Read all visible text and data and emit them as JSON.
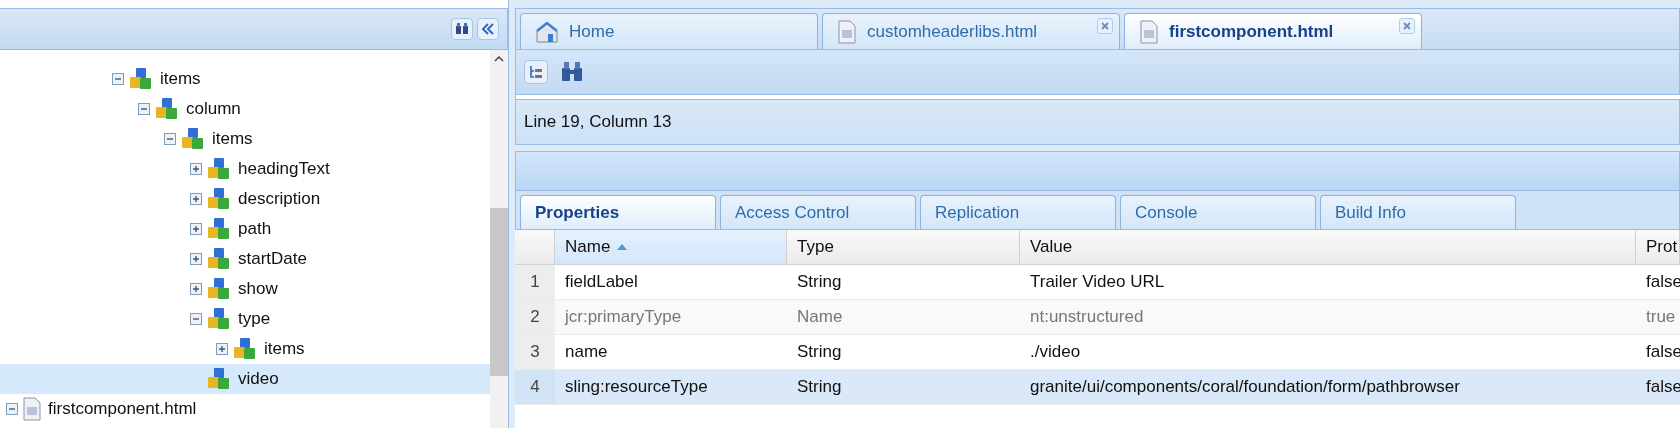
{
  "tree": [
    {
      "label": "items",
      "kind": "node",
      "expanded": true,
      "selected": false,
      "children": [
        {
          "label": "column",
          "kind": "node",
          "expanded": true,
          "selected": false,
          "children": [
            {
              "label": "items",
              "kind": "node",
              "expanded": true,
              "selected": false,
              "children": [
                {
                  "label": "headingText",
                  "kind": "node",
                  "expanded": false,
                  "selected": false
                },
                {
                  "label": "description",
                  "kind": "node",
                  "expanded": false,
                  "selected": false
                },
                {
                  "label": "path",
                  "kind": "node",
                  "expanded": false,
                  "selected": false
                },
                {
                  "label": "startDate",
                  "kind": "node",
                  "expanded": false,
                  "selected": false
                },
                {
                  "label": "show",
                  "kind": "node",
                  "expanded": false,
                  "selected": false
                },
                {
                  "label": "type",
                  "kind": "node",
                  "expanded": true,
                  "selected": false,
                  "children": [
                    {
                      "label": "items",
                      "kind": "node",
                      "expanded": false,
                      "selected": false
                    }
                  ]
                },
                {
                  "label": "video",
                  "kind": "leaf",
                  "selected": true
                }
              ]
            }
          ]
        }
      ]
    },
    {
      "label": "firstcomponent.html",
      "kind": "file",
      "expanded": true,
      "selected": false
    }
  ],
  "editor_tabs": [
    {
      "label": "Home",
      "kind": "home",
      "selected": false,
      "closable": false
    },
    {
      "label": "customheaderlibs.html",
      "kind": "file",
      "selected": false,
      "closable": true
    },
    {
      "label": "firstcomponent.html",
      "kind": "file",
      "selected": true,
      "closable": true
    }
  ],
  "status": "Line 19, Column 13",
  "panel_tabs": [
    {
      "label": "Properties",
      "selected": true
    },
    {
      "label": "Access Control",
      "selected": false
    },
    {
      "label": "Replication",
      "selected": false
    },
    {
      "label": "Console",
      "selected": false
    },
    {
      "label": "Build Info",
      "selected": false
    }
  ],
  "table": {
    "columns": [
      {
        "label": "Name",
        "sorted": true
      },
      {
        "label": "Type"
      },
      {
        "label": "Value"
      },
      {
        "label": "Prot"
      }
    ],
    "rows": [
      {
        "index": "1",
        "cells": [
          "fieldLabel",
          "String",
          "Trailer Video URL",
          "false"
        ],
        "protected": false,
        "selected": false
      },
      {
        "index": "2",
        "cells": [
          "jcr:primaryType",
          "Name",
          "nt:unstructured",
          "true"
        ],
        "protected": true,
        "selected": false
      },
      {
        "index": "3",
        "cells": [
          "name",
          "String",
          "./video",
          "false"
        ],
        "protected": false,
        "selected": false
      },
      {
        "index": "4",
        "cells": [
          "sling:resourceType",
          "String",
          "granite/ui/components/coral/foundation/form/pathbrowser",
          "false"
        ],
        "protected": false,
        "selected": true
      }
    ]
  }
}
